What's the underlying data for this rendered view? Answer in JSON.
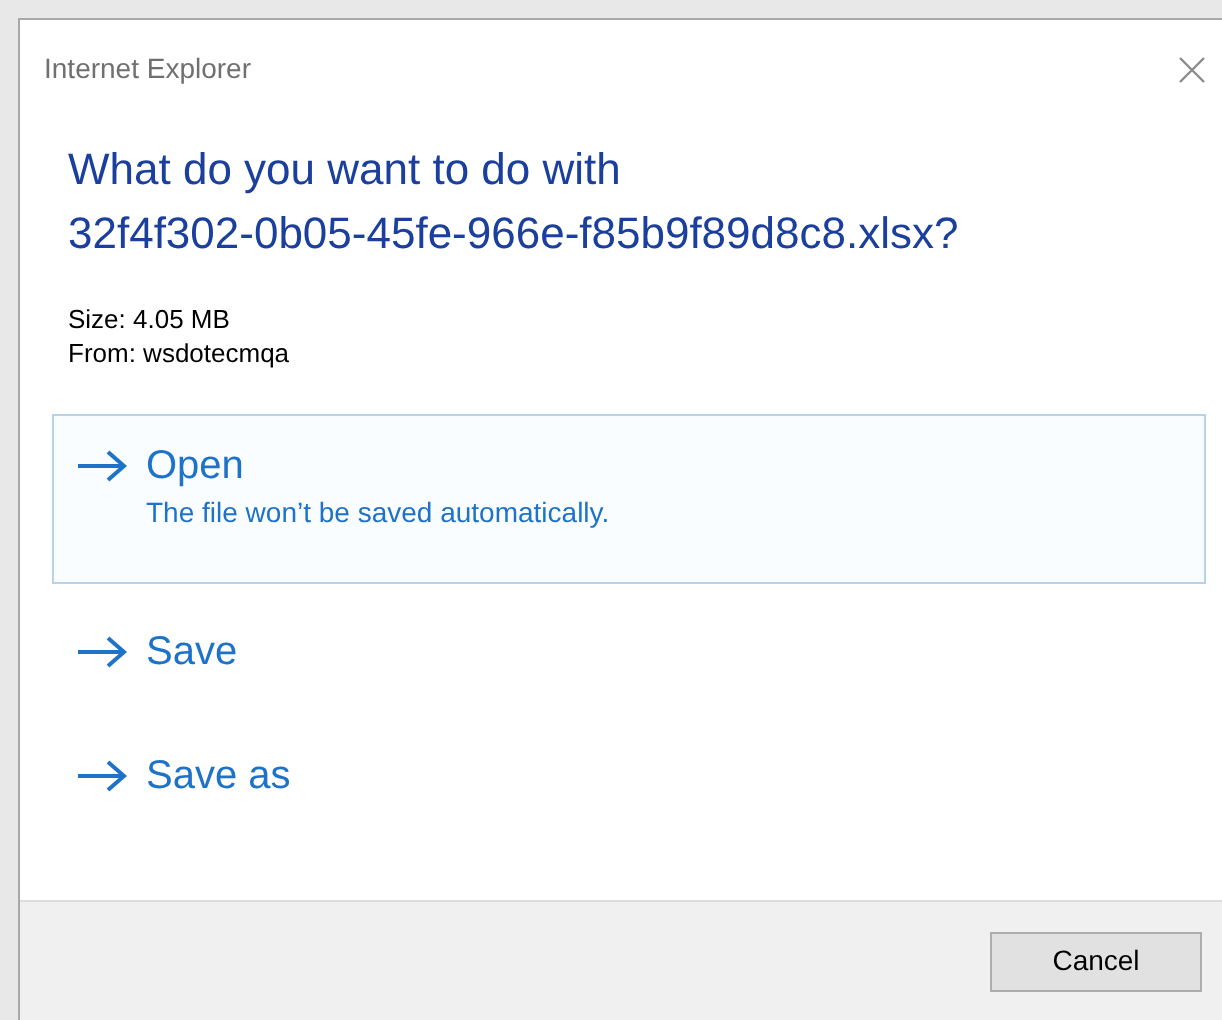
{
  "window": {
    "title": "Internet Explorer"
  },
  "heading": [
    "What do you want to do with",
    "32f4f302-0b05-45fe-966e-f85b9f89d8c8.xlsx?"
  ],
  "details": [
    "Size: 4.05 MB",
    "From: wsdotecmqa"
  ],
  "options": [
    {
      "label": "Open",
      "description": "The file won’t be saved automatically.",
      "selected": true
    },
    {
      "label": "Save",
      "selected": false
    },
    {
      "label": "Save as",
      "selected": false
    }
  ],
  "buttons": [
    "Cancel"
  ]
}
